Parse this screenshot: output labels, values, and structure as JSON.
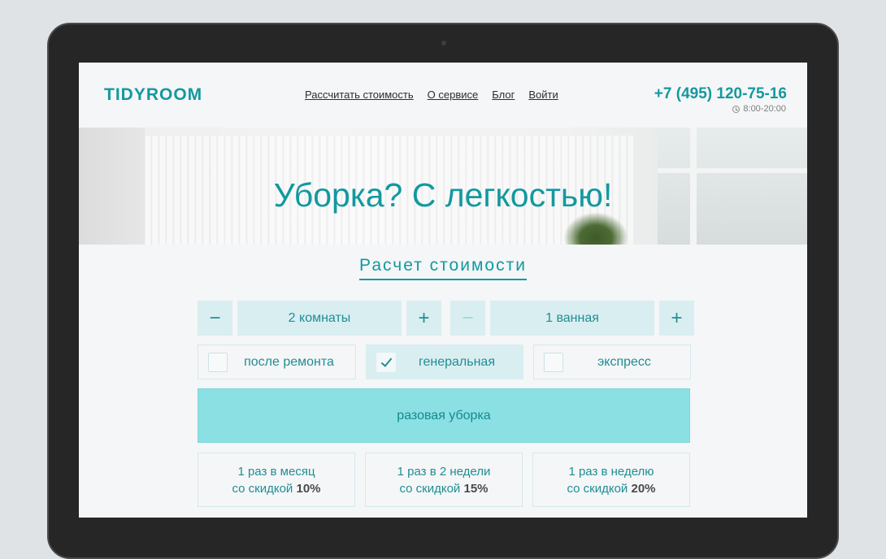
{
  "header": {
    "logo": "TIDYROOM",
    "nav": [
      "Рассчитать стоимость",
      "О сервисе",
      "Блог",
      "Войти"
    ],
    "phone": "+7 (495) 120-75-16",
    "hours": "8:00-20:00"
  },
  "hero": {
    "title": "Уборка? С легкостью!"
  },
  "calculator": {
    "title": "Расчет стоимости",
    "rooms": {
      "minus": "−",
      "value": "2 комнаты",
      "plus": "+"
    },
    "bathrooms": {
      "minus": "−",
      "value": "1 ванная",
      "plus": "+"
    },
    "options": [
      {
        "label": "после ремонта",
        "checked": false
      },
      {
        "label": "генеральная",
        "checked": true
      },
      {
        "label": "экспресс",
        "checked": false
      }
    ],
    "one_time": "разовая уборка",
    "plans": [
      {
        "line1": "1 раз в месяц",
        "line2": "со скидкой",
        "discount": "10%"
      },
      {
        "line1": "1 раз в 2 недели",
        "line2": "со скидкой",
        "discount": "15%"
      },
      {
        "line1": "1 раз в неделю",
        "line2": "со скидкой",
        "discount": "20%"
      }
    ]
  },
  "colors": {
    "accent": "#12999f",
    "one_time_bg": "#8ae0e3",
    "cell_bg": "#d9eef1"
  }
}
